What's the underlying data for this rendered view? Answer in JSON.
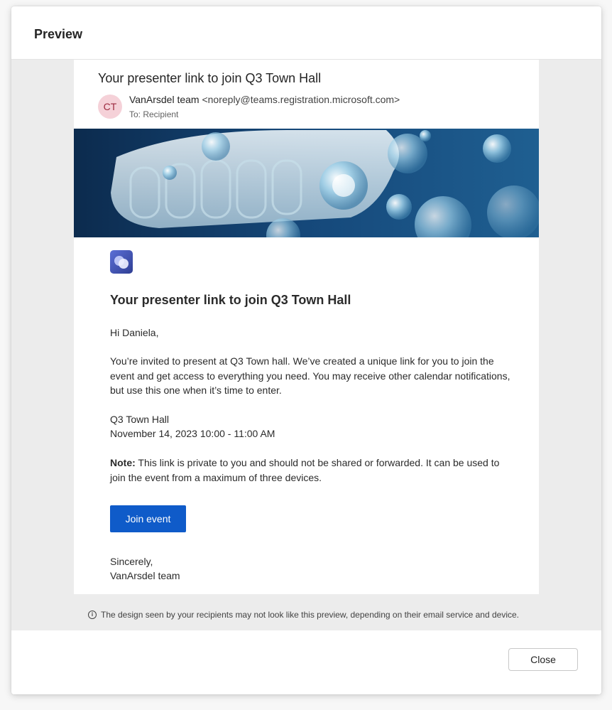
{
  "dialog": {
    "title": "Preview",
    "close_label": "Close",
    "disclaimer": "The design seen by your recipients may not look like this preview, depending on their email service and device."
  },
  "email": {
    "subject": "Your presenter link to join Q3 Town Hall",
    "sender_initials": "CT",
    "sender_name": "VanArsdel team",
    "sender_email": "<noreply@teams.registration.microsoft.com>",
    "to_line": "To: Recipient",
    "heading": "Your presenter link to join Q3 Town Hall",
    "greeting": "Hi Daniela,",
    "intro": "You’re invited to present at Q3 Town hall. We’ve created a unique link for you to join the event and get access to everything you need. You may receive other calendar notifications, but use this one when it’s time to enter.",
    "event_name": "Q3 Town Hall",
    "event_time": "November 14, 2023 10:00 - 11:00 AM",
    "note_label": "Note:",
    "note_text": " This link is private to you and should not be shared or forwarded. It can be used to join the event from a maximum of three devices.",
    "join_label": "Join event",
    "signoff": "Sincerely,",
    "signature": "VanArsdel team"
  },
  "colors": {
    "accent": "#0f5bc9",
    "avatar_bg": "#f5d1d8",
    "banner_bg": "#14406e"
  },
  "icons": {
    "logo": "teams-logo-icon",
    "info": "info-icon"
  }
}
